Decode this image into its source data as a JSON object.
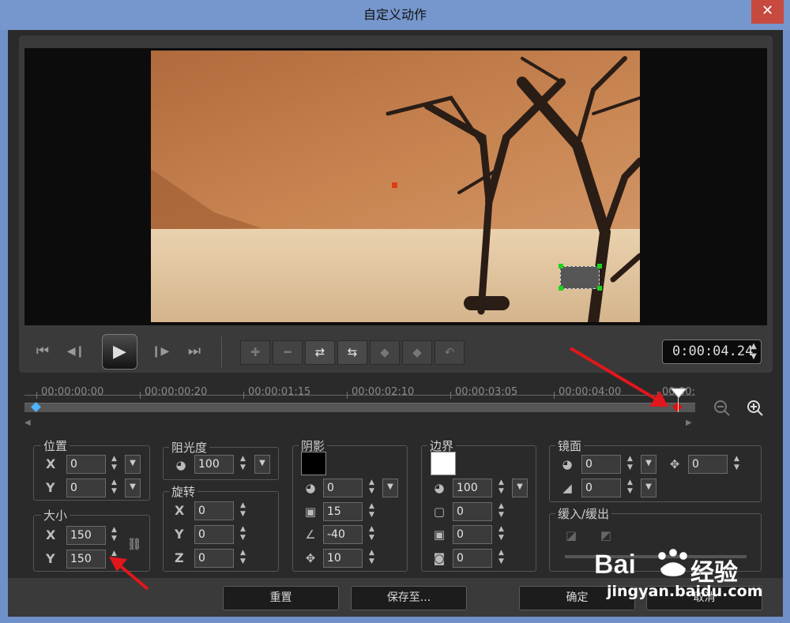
{
  "window": {
    "title": "自定义动作",
    "close_glyph": "✕"
  },
  "playback": {
    "buttons": [
      {
        "name": "go-to-start-icon",
        "glyph": "⏮"
      },
      {
        "name": "previous-frame-icon",
        "glyph": "◀❙"
      },
      {
        "name": "play-icon",
        "glyph": "▶"
      },
      {
        "name": "next-frame-icon",
        "glyph": "❙▶"
      },
      {
        "name": "go-to-end-icon",
        "glyph": "⏭"
      }
    ],
    "timecode": "0:00:04.24"
  },
  "keyframe_tools": [
    {
      "name": "add-keyframe-icon",
      "glyph": "✚",
      "enabled": false
    },
    {
      "name": "remove-keyframe-icon",
      "glyph": "━",
      "enabled": false
    },
    {
      "name": "reverse-keyframe-icon",
      "glyph": "⇄",
      "enabled": true
    },
    {
      "name": "swap-keyframe-icon",
      "glyph": "⇆",
      "enabled": true
    },
    {
      "name": "previous-keyframe-icon",
      "glyph": "◆",
      "enabled": false
    },
    {
      "name": "next-keyframe-icon",
      "glyph": "◆",
      "enabled": false
    },
    {
      "name": "undo-keyframe-icon",
      "glyph": "↶",
      "enabled": false
    }
  ],
  "timeline": {
    "ticks": [
      "00:00:00:00",
      "00:00:00:20",
      "00:00:01:15",
      "00:00:02:10",
      "00:00:03:05",
      "00:00:04:00",
      "00:00:"
    ],
    "zoom_out_icon": "zoom-out-icon",
    "zoom_in_icon": "zoom-in-icon"
  },
  "position": {
    "title": "位置",
    "x_label": "X",
    "x": "0",
    "y_label": "Y",
    "y": "0"
  },
  "size": {
    "title": "大小",
    "x_label": "X",
    "x": "150",
    "y_label": "Y",
    "y": "150"
  },
  "opacity": {
    "title": "阻光度",
    "value": "100"
  },
  "rotation": {
    "title": "旋转",
    "x_label": "X",
    "x": "0",
    "y_label": "Y",
    "y": "0",
    "z_label": "Z",
    "z": "0"
  },
  "shadow": {
    "title": "阴影",
    "color": "#000000",
    "opacity": "0",
    "blur": "15",
    "angle": "-40",
    "distance": "10"
  },
  "border": {
    "title": "边界",
    "color": "#ffffff",
    "opacity": "100",
    "size": "0",
    "blur": "0",
    "corner": "0"
  },
  "mirror": {
    "title": "镜面",
    "opacity": "0",
    "distance": "0",
    "fade": "0"
  },
  "ease": {
    "title": "缓入/缓出"
  },
  "footer": {
    "reset": "重置",
    "save_to": "保存至...",
    "ok": "确定",
    "cancel": "取消"
  },
  "watermark": {
    "brand": "Bai",
    "brand2": "经验",
    "url": "jingyan.baidu.com"
  }
}
